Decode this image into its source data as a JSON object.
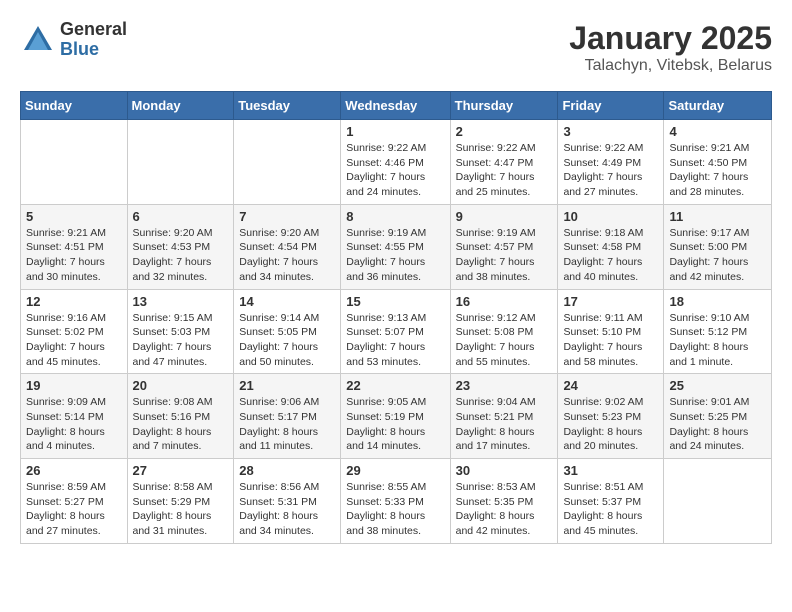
{
  "header": {
    "logo_general": "General",
    "logo_blue": "Blue",
    "month_title": "January 2025",
    "location": "Talachyn, Vitebsk, Belarus"
  },
  "weekdays": [
    "Sunday",
    "Monday",
    "Tuesday",
    "Wednesday",
    "Thursday",
    "Friday",
    "Saturday"
  ],
  "weeks": [
    [
      {
        "day": "",
        "info": ""
      },
      {
        "day": "",
        "info": ""
      },
      {
        "day": "",
        "info": ""
      },
      {
        "day": "1",
        "info": "Sunrise: 9:22 AM\nSunset: 4:46 PM\nDaylight: 7 hours\nand 24 minutes."
      },
      {
        "day": "2",
        "info": "Sunrise: 9:22 AM\nSunset: 4:47 PM\nDaylight: 7 hours\nand 25 minutes."
      },
      {
        "day": "3",
        "info": "Sunrise: 9:22 AM\nSunset: 4:49 PM\nDaylight: 7 hours\nand 27 minutes."
      },
      {
        "day": "4",
        "info": "Sunrise: 9:21 AM\nSunset: 4:50 PM\nDaylight: 7 hours\nand 28 minutes."
      }
    ],
    [
      {
        "day": "5",
        "info": "Sunrise: 9:21 AM\nSunset: 4:51 PM\nDaylight: 7 hours\nand 30 minutes."
      },
      {
        "day": "6",
        "info": "Sunrise: 9:20 AM\nSunset: 4:53 PM\nDaylight: 7 hours\nand 32 minutes."
      },
      {
        "day": "7",
        "info": "Sunrise: 9:20 AM\nSunset: 4:54 PM\nDaylight: 7 hours\nand 34 minutes."
      },
      {
        "day": "8",
        "info": "Sunrise: 9:19 AM\nSunset: 4:55 PM\nDaylight: 7 hours\nand 36 minutes."
      },
      {
        "day": "9",
        "info": "Sunrise: 9:19 AM\nSunset: 4:57 PM\nDaylight: 7 hours\nand 38 minutes."
      },
      {
        "day": "10",
        "info": "Sunrise: 9:18 AM\nSunset: 4:58 PM\nDaylight: 7 hours\nand 40 minutes."
      },
      {
        "day": "11",
        "info": "Sunrise: 9:17 AM\nSunset: 5:00 PM\nDaylight: 7 hours\nand 42 minutes."
      }
    ],
    [
      {
        "day": "12",
        "info": "Sunrise: 9:16 AM\nSunset: 5:02 PM\nDaylight: 7 hours\nand 45 minutes."
      },
      {
        "day": "13",
        "info": "Sunrise: 9:15 AM\nSunset: 5:03 PM\nDaylight: 7 hours\nand 47 minutes."
      },
      {
        "day": "14",
        "info": "Sunrise: 9:14 AM\nSunset: 5:05 PM\nDaylight: 7 hours\nand 50 minutes."
      },
      {
        "day": "15",
        "info": "Sunrise: 9:13 AM\nSunset: 5:07 PM\nDaylight: 7 hours\nand 53 minutes."
      },
      {
        "day": "16",
        "info": "Sunrise: 9:12 AM\nSunset: 5:08 PM\nDaylight: 7 hours\nand 55 minutes."
      },
      {
        "day": "17",
        "info": "Sunrise: 9:11 AM\nSunset: 5:10 PM\nDaylight: 7 hours\nand 58 minutes."
      },
      {
        "day": "18",
        "info": "Sunrise: 9:10 AM\nSunset: 5:12 PM\nDaylight: 8 hours\nand 1 minute."
      }
    ],
    [
      {
        "day": "19",
        "info": "Sunrise: 9:09 AM\nSunset: 5:14 PM\nDaylight: 8 hours\nand 4 minutes."
      },
      {
        "day": "20",
        "info": "Sunrise: 9:08 AM\nSunset: 5:16 PM\nDaylight: 8 hours\nand 7 minutes."
      },
      {
        "day": "21",
        "info": "Sunrise: 9:06 AM\nSunset: 5:17 PM\nDaylight: 8 hours\nand 11 minutes."
      },
      {
        "day": "22",
        "info": "Sunrise: 9:05 AM\nSunset: 5:19 PM\nDaylight: 8 hours\nand 14 minutes."
      },
      {
        "day": "23",
        "info": "Sunrise: 9:04 AM\nSunset: 5:21 PM\nDaylight: 8 hours\nand 17 minutes."
      },
      {
        "day": "24",
        "info": "Sunrise: 9:02 AM\nSunset: 5:23 PM\nDaylight: 8 hours\nand 20 minutes."
      },
      {
        "day": "25",
        "info": "Sunrise: 9:01 AM\nSunset: 5:25 PM\nDaylight: 8 hours\nand 24 minutes."
      }
    ],
    [
      {
        "day": "26",
        "info": "Sunrise: 8:59 AM\nSunset: 5:27 PM\nDaylight: 8 hours\nand 27 minutes."
      },
      {
        "day": "27",
        "info": "Sunrise: 8:58 AM\nSunset: 5:29 PM\nDaylight: 8 hours\nand 31 minutes."
      },
      {
        "day": "28",
        "info": "Sunrise: 8:56 AM\nSunset: 5:31 PM\nDaylight: 8 hours\nand 34 minutes."
      },
      {
        "day": "29",
        "info": "Sunrise: 8:55 AM\nSunset: 5:33 PM\nDaylight: 8 hours\nand 38 minutes."
      },
      {
        "day": "30",
        "info": "Sunrise: 8:53 AM\nSunset: 5:35 PM\nDaylight: 8 hours\nand 42 minutes."
      },
      {
        "day": "31",
        "info": "Sunrise: 8:51 AM\nSunset: 5:37 PM\nDaylight: 8 hours\nand 45 minutes."
      },
      {
        "day": "",
        "info": ""
      }
    ]
  ]
}
